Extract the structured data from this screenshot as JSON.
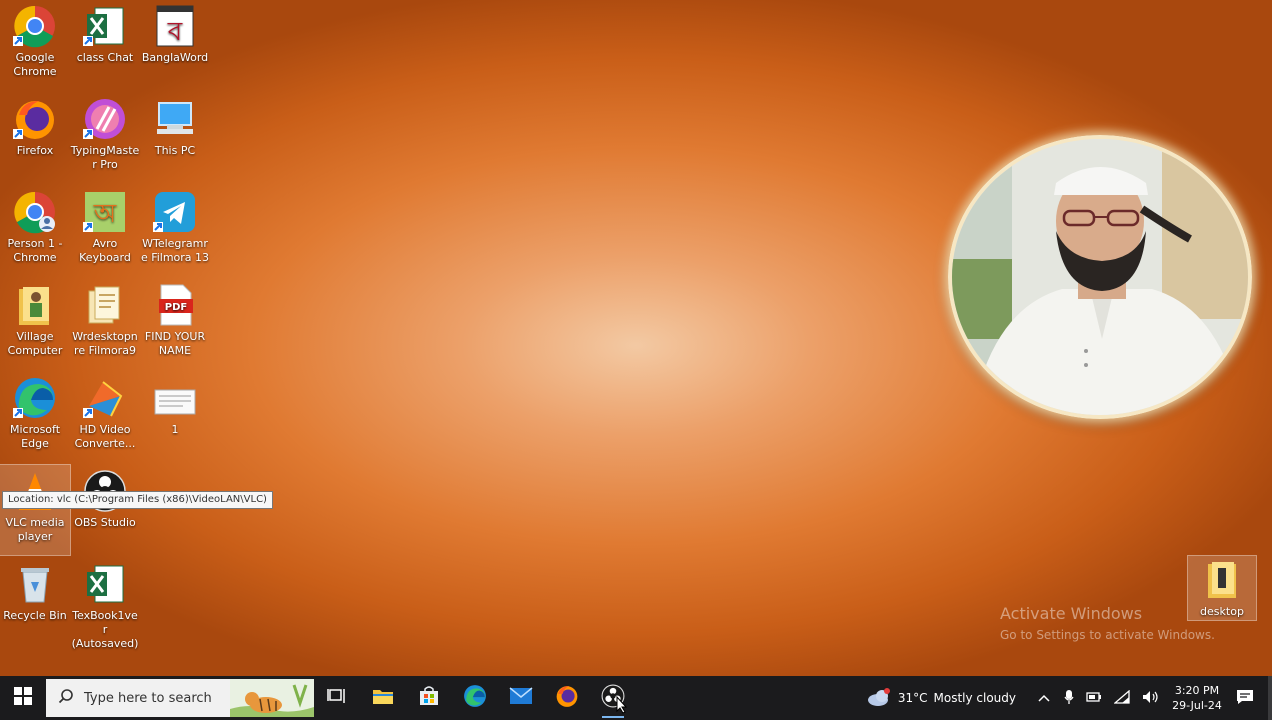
{
  "desktop": {
    "icons": [
      {
        "label": "Google Chrome"
      },
      {
        "label": "class Chat"
      },
      {
        "label": "BanglaWord"
      },
      {
        "label": "Firefox"
      },
      {
        "label": "TypingMaster Pro"
      },
      {
        "label": "This PC"
      },
      {
        "label": "Person 1 - Chrome"
      },
      {
        "label": "Avro Keyboard"
      },
      {
        "label": "WTelegramre Filmora 13"
      },
      {
        "label": "Village Computer"
      },
      {
        "label": "Wrdesktopnre Filmora9"
      },
      {
        "label": "FIND YOUR NAME"
      },
      {
        "label": "Microsoft Edge"
      },
      {
        "label": "HD Video Converte..."
      },
      {
        "label": "1"
      },
      {
        "label": "VLC media player"
      },
      {
        "label": "OBS Studio"
      },
      {
        "label": "Recycle Bin"
      },
      {
        "label": "TexBook1ver (Autosaved)"
      },
      {
        "label": "desktop"
      }
    ],
    "tooltip": "Location: vlc (C:\\Program Files (x86)\\VideoLAN\\VLC)",
    "watermark_title": "Activate Windows",
    "watermark_sub": "Go to Settings to activate Windows."
  },
  "taskbar": {
    "search_placeholder": "Type here to search",
    "weather": {
      "temp": "31°C",
      "condition": "Mostly cloudy"
    },
    "clock": {
      "time": "3:20 PM",
      "date": "29-Jul-24"
    }
  },
  "colors": {
    "taskbar_bg": "#1b1b1d",
    "desktop_accent": "#e07a32",
    "active_indicator": "#7cb7f0"
  }
}
